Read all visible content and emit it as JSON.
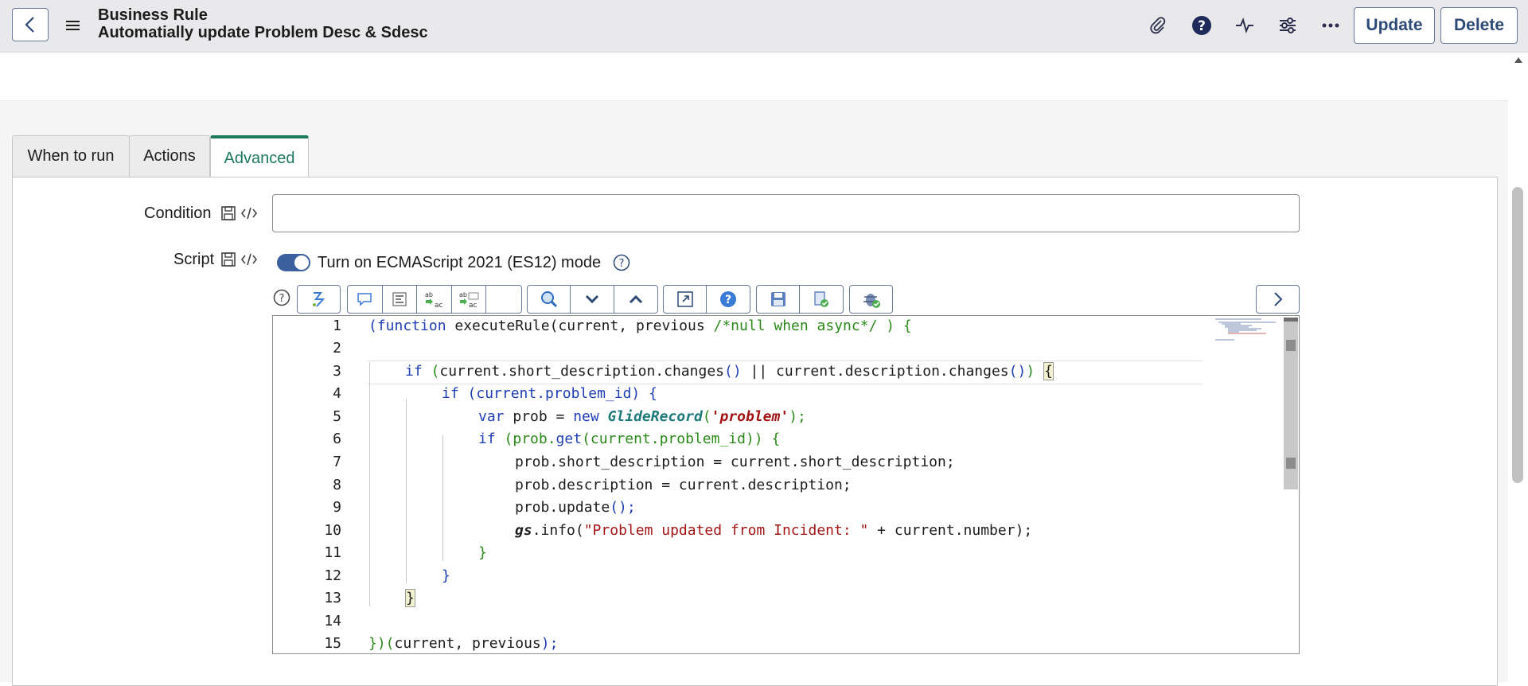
{
  "header": {
    "record_type": "Business Rule",
    "record_name": "Automatially update Problem Desc & Sdesc",
    "update_label": "Update",
    "delete_label": "Delete",
    "icons": [
      "back-icon",
      "hamburger-menu-icon",
      "paperclip-icon",
      "help-icon",
      "activity-pulse-icon",
      "settings-sliders-icon",
      "more-options-icon"
    ]
  },
  "tabs": [
    {
      "label": "When to run",
      "active": false
    },
    {
      "label": "Actions",
      "active": false
    },
    {
      "label": "Advanced",
      "active": true
    }
  ],
  "form": {
    "condition_label": "Condition",
    "condition_value": "",
    "script_label": "Script",
    "es12_toggle_label": "Turn on ECMAScript 2021 (ES12) mode",
    "es12_toggle_on": true
  },
  "editor": {
    "line_numbers": [
      "1",
      "2",
      "3",
      "4",
      "5",
      "6",
      "7",
      "8",
      "9",
      "10",
      "11",
      "12",
      "13",
      "14",
      "15"
    ],
    "toolbar_icons": [
      "help-icon",
      "format-code-icon",
      "comment-icon",
      "toggle-syntax-icon",
      "replace-icon",
      "replace-all-icon",
      "search-icon",
      "find-next-icon",
      "find-previous-icon",
      "fullscreen-icon",
      "script-help-icon",
      "save-icon",
      "validate-script-icon",
      "debug-icon",
      "next-arrow-icon"
    ],
    "code": {
      "l1_a": "(function",
      "l1_b": " executeRule",
      "l1_c": "(current, previous ",
      "l1_d": "/*null when async*/",
      "l1_e": " ) {",
      "l3_a": "if",
      "l3_b": " (",
      "l3_c": "current.short_description.changes",
      "l3_d": "()",
      "l3_e": " || current.description.changes",
      "l3_f": "()",
      "l3_g": ") ",
      "l3_h": "{",
      "l4_a": "if",
      "l4_b": " (current.problem_id) {",
      "l5_a": "var",
      "l5_b": " prob = ",
      "l5_c": "new",
      "l5_d": "GlideRecord",
      "l5_e": "(",
      "l5_f": "'problem'",
      "l5_g": ");",
      "l6_a": "if",
      "l6_b": " (prob.",
      "l6_c": "get",
      "l6_d": "(current.problem_id)) {",
      "l7": "prob.short_description = current.short_description;",
      "l8": "prob.description = current.description;",
      "l9_a": "prob.update",
      "l9_b": "();",
      "l10_a": "gs",
      "l10_b": ".info(",
      "l10_c": "\"Problem updated from Incident: \"",
      "l10_d": " + current.number);",
      "l11": "}",
      "l12": "}",
      "l13": "}",
      "l15_a": "})(",
      "l15_b": "current, previous",
      "l15_c": ");"
    }
  }
}
